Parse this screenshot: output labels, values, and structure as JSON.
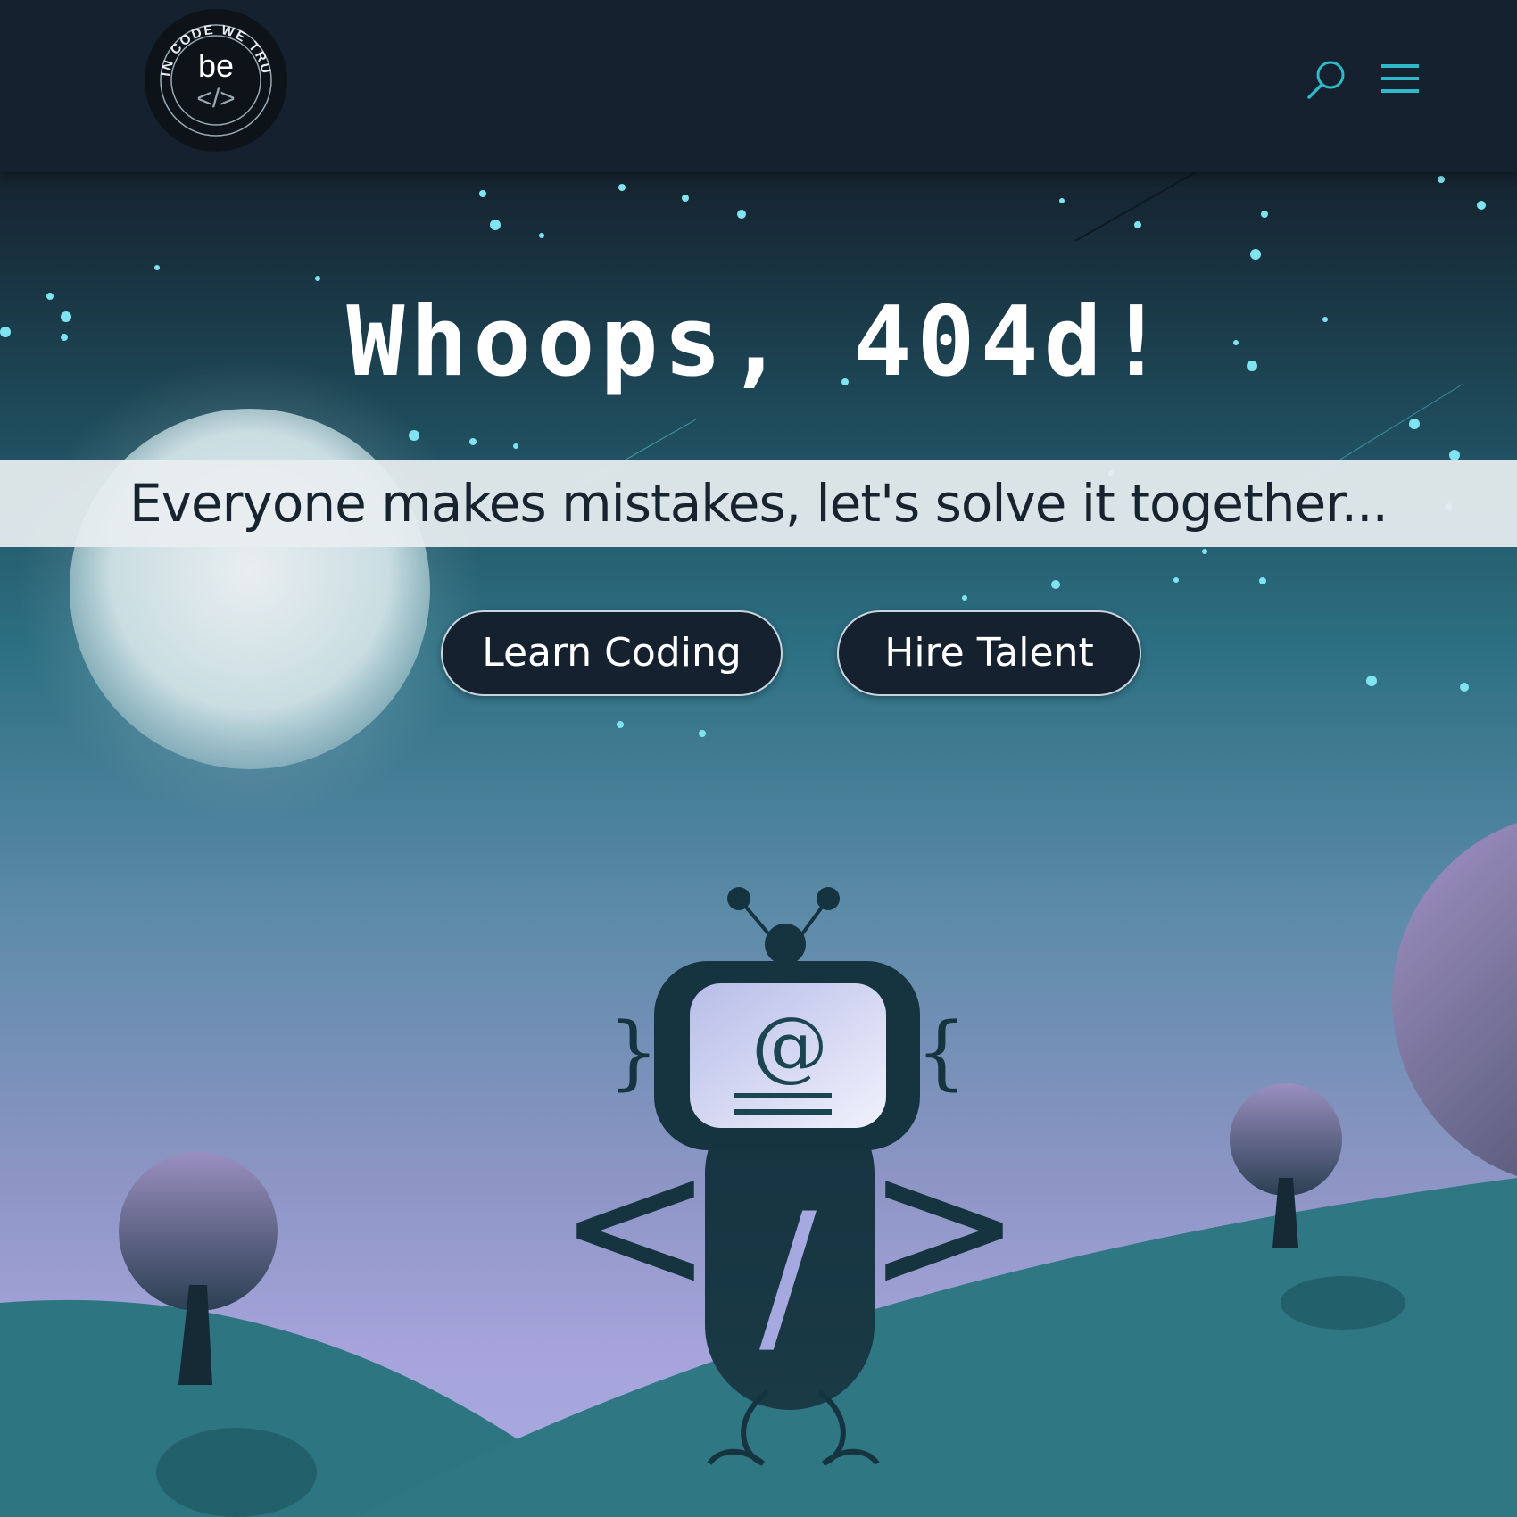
{
  "header": {
    "logo": {
      "ring_text": "IN CODE WE TRUST",
      "mark": "be",
      "sub_mark": "</>"
    },
    "search_icon": "search-icon",
    "menu_icon": "hamburger-menu-icon"
  },
  "main": {
    "headline": "Whoops, 404d!",
    "tagline": "Everyone makes mistakes, let's solve it together...",
    "buttons": [
      {
        "label": "Learn Coding"
      },
      {
        "label": "Hire Talent"
      }
    ]
  },
  "illustration": {
    "robot_screen_symbol": "@",
    "robot_body_symbol": "/",
    "left_bracket": "<",
    "right_bracket": ">",
    "left_brace": "}",
    "right_brace": "{"
  },
  "colors": {
    "header_bg": "#15212f",
    "accent": "#2fb9c9",
    "button_bg": "#15212f",
    "robot_dark": "#163340",
    "screen_light": "#dcdcf5"
  }
}
